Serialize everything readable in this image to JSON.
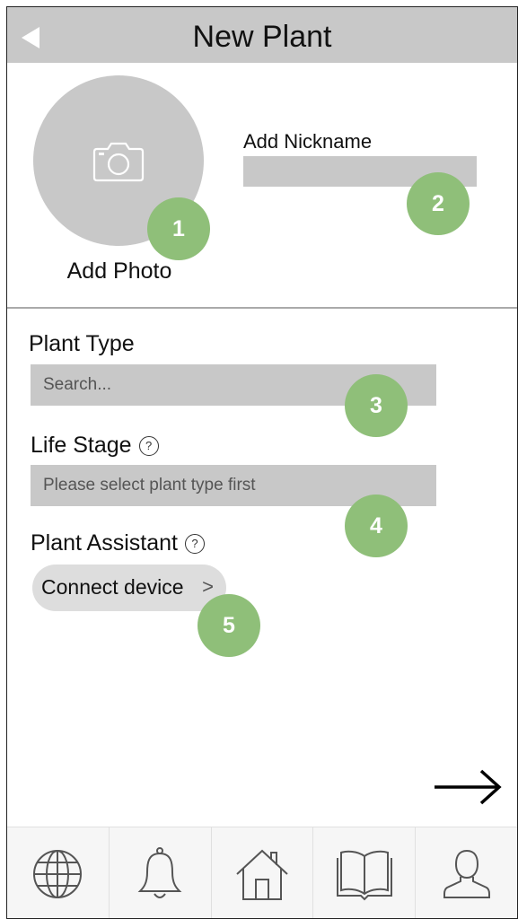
{
  "header": {
    "title": "New Plant",
    "back_icon": "back-triangle-icon"
  },
  "photo": {
    "label": "Add Photo",
    "icon": "camera-icon"
  },
  "nickname": {
    "label": "Add Nickname",
    "value": ""
  },
  "plant_type": {
    "label": "Plant Type",
    "placeholder": "Search..."
  },
  "life_stage": {
    "label": "Life Stage",
    "help": "?",
    "placeholder": "Please select plant type first"
  },
  "assistant": {
    "label": "Plant Assistant",
    "help": "?",
    "button_label": "Connect device",
    "chevron": ">"
  },
  "badges": [
    "1",
    "2",
    "3",
    "4",
    "5"
  ],
  "badge_color": "#8fbf79",
  "next": {
    "icon": "right-arrow-icon"
  },
  "tabbar": {
    "items": [
      {
        "icon": "globe-icon"
      },
      {
        "icon": "bell-icon"
      },
      {
        "icon": "home-icon"
      },
      {
        "icon": "book-icon"
      },
      {
        "icon": "user-icon"
      }
    ]
  }
}
